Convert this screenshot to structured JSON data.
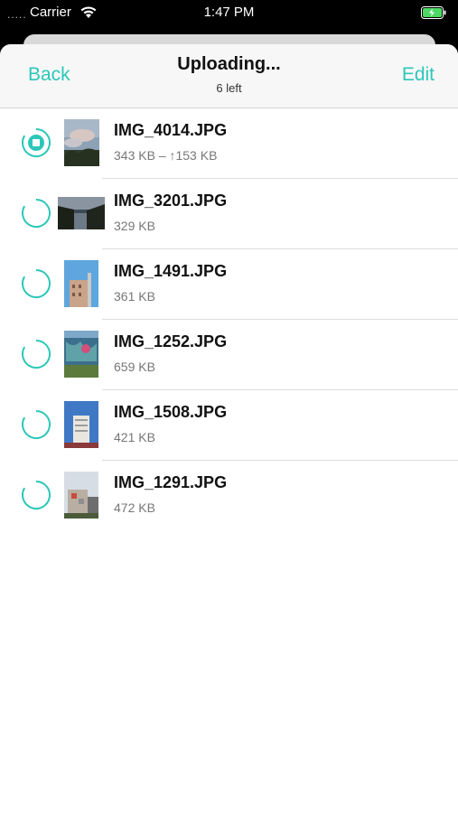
{
  "status_bar": {
    "signal": ".....",
    "carrier": "Carrier",
    "time": "1:47 PM"
  },
  "nav": {
    "back_label": "Back",
    "title": "Uploading...",
    "subtitle": "6 left",
    "edit_label": "Edit"
  },
  "colors": {
    "accent": "#2cc7b8"
  },
  "files": [
    {
      "name": "IMG_4014.JPG",
      "size": "343 KB – ↑153 KB",
      "status": "uploading",
      "thumb": "sky-tree"
    },
    {
      "name": "IMG_3201.JPG",
      "size": "329 KB",
      "status": "pending",
      "thumb": "canal-dusk"
    },
    {
      "name": "IMG_1491.JPG",
      "size": "361 KB",
      "status": "pending",
      "thumb": "building-blue-sky"
    },
    {
      "name": "IMG_1252.JPG",
      "size": "659 KB",
      "status": "pending",
      "thumb": "mural-wall"
    },
    {
      "name": "IMG_1508.JPG",
      "size": "421 KB",
      "status": "pending",
      "thumb": "tower-block"
    },
    {
      "name": "IMG_1291.JPG",
      "size": "472 KB",
      "status": "pending",
      "thumb": "street-building"
    }
  ]
}
